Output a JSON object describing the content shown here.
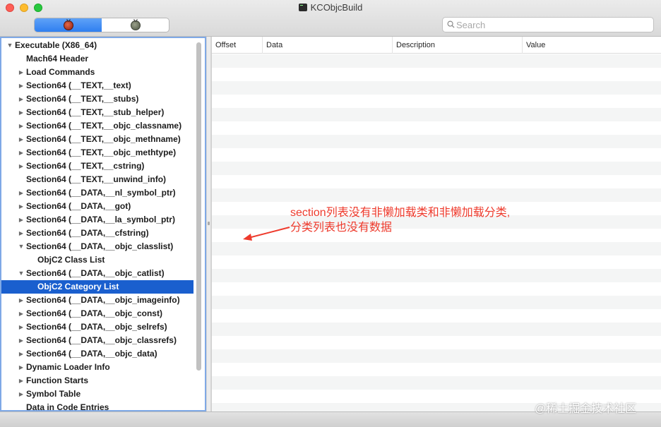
{
  "window": {
    "title": "KCObjcBuild"
  },
  "toolbar": {
    "segments": [
      {
        "icon": "bug-red-icon",
        "selected": true
      },
      {
        "icon": "bug-gray-icon",
        "selected": false
      }
    ],
    "search": {
      "placeholder": "Search",
      "value": ""
    }
  },
  "sidebar": {
    "items": [
      {
        "label": "Executable  (X86_64)",
        "level": 0,
        "disclosure": "open"
      },
      {
        "label": "Mach64 Header",
        "level": 1,
        "disclosure": "none"
      },
      {
        "label": "Load Commands",
        "level": 1,
        "disclosure": "closed"
      },
      {
        "label": "Section64 (__TEXT,__text)",
        "level": 1,
        "disclosure": "closed"
      },
      {
        "label": "Section64 (__TEXT,__stubs)",
        "level": 1,
        "disclosure": "closed"
      },
      {
        "label": "Section64 (__TEXT,__stub_helper)",
        "level": 1,
        "disclosure": "closed"
      },
      {
        "label": "Section64 (__TEXT,__objc_classname)",
        "level": 1,
        "disclosure": "closed"
      },
      {
        "label": "Section64 (__TEXT,__objc_methname)",
        "level": 1,
        "disclosure": "closed"
      },
      {
        "label": "Section64 (__TEXT,__objc_methtype)",
        "level": 1,
        "disclosure": "closed"
      },
      {
        "label": "Section64 (__TEXT,__cstring)",
        "level": 1,
        "disclosure": "closed"
      },
      {
        "label": "Section64 (__TEXT,__unwind_info)",
        "level": 1,
        "disclosure": "none"
      },
      {
        "label": "Section64 (__DATA,__nl_symbol_ptr)",
        "level": 1,
        "disclosure": "closed"
      },
      {
        "label": "Section64 (__DATA,__got)",
        "level": 1,
        "disclosure": "closed"
      },
      {
        "label": "Section64 (__DATA,__la_symbol_ptr)",
        "level": 1,
        "disclosure": "closed"
      },
      {
        "label": "Section64 (__DATA,__cfstring)",
        "level": 1,
        "disclosure": "closed"
      },
      {
        "label": "Section64 (__DATA,__objc_classlist)",
        "level": 1,
        "disclosure": "open"
      },
      {
        "label": "ObjC2 Class List",
        "level": 2,
        "disclosure": "none"
      },
      {
        "label": "Section64 (__DATA,__objc_catlist)",
        "level": 1,
        "disclosure": "open"
      },
      {
        "label": "ObjC2 Category List",
        "level": 2,
        "disclosure": "none",
        "selected": true
      },
      {
        "label": "Section64 (__DATA,__objc_imageinfo)",
        "level": 1,
        "disclosure": "closed"
      },
      {
        "label": "Section64 (__DATA,__objc_const)",
        "level": 1,
        "disclosure": "closed"
      },
      {
        "label": "Section64 (__DATA,__objc_selrefs)",
        "level": 1,
        "disclosure": "closed"
      },
      {
        "label": "Section64 (__DATA,__objc_classrefs)",
        "level": 1,
        "disclosure": "closed"
      },
      {
        "label": "Section64 (__DATA,__objc_data)",
        "level": 1,
        "disclosure": "closed"
      },
      {
        "label": "Dynamic Loader Info",
        "level": 1,
        "disclosure": "closed"
      },
      {
        "label": "Function Starts",
        "level": 1,
        "disclosure": "closed"
      },
      {
        "label": "Symbol Table",
        "level": 1,
        "disclosure": "closed"
      },
      {
        "label": "Data in Code Entries",
        "level": 1,
        "disclosure": "none"
      }
    ]
  },
  "table": {
    "columns": [
      "Offset",
      "Data",
      "Description",
      "Value"
    ],
    "rows": []
  },
  "annotation": {
    "lines": [
      "section列表没有非懒加载类和非懒加载分类,",
      "分类列表也没有数据"
    ],
    "color": "#ee3a2c"
  },
  "watermark": "@稀土掘金技术社区",
  "colors": {
    "selection": "#1a5fce",
    "focus_ring": "#7fa9e6",
    "segment_selected": "#2f7ff0"
  }
}
